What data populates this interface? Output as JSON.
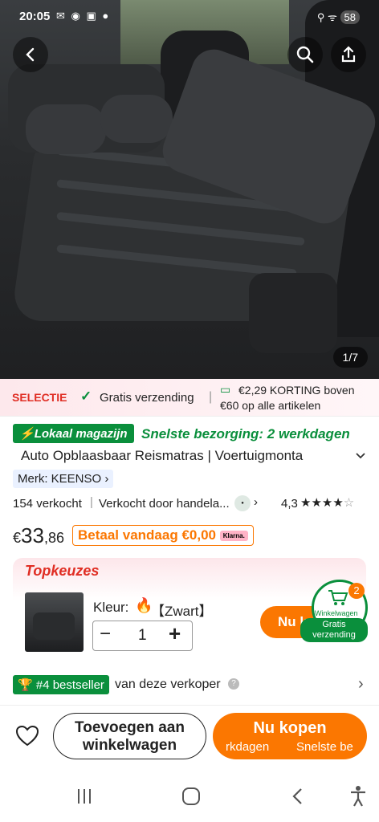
{
  "status_bar": {
    "time": "20:05",
    "battery": "58"
  },
  "gallery": {
    "counter": "1/7"
  },
  "promo": {
    "selectie": "SELECTIE",
    "shipping": "Gratis verzending",
    "discount_line1": "€2,29 KORTING boven",
    "discount_line2": "€60 op alle artikelen"
  },
  "delivery": {
    "badge": "Lokaal magazijn",
    "text": "Snelste bezorging: 2 werkdagen"
  },
  "product": {
    "title": "Auto Opblaasbaar Reismatras | Voertuigmonta",
    "brand": "Merk: KEENSO",
    "sold": "154 verkocht",
    "seller": "Verkocht door handela...",
    "rating": "4,3",
    "price_symbol": "€",
    "price_main": "33",
    "price_cents": ",86",
    "pay_today": "Betaal vandaag €0,00",
    "klarna": "Klarna."
  },
  "topkeuzes": {
    "title": "Topkeuzes",
    "color_label": "Kleur:",
    "color_value": "【Zwart】",
    "quantity": "1",
    "buy_now": "Nu k",
    "cart_badge_count": "2",
    "cart_label": "Winkelwagen",
    "cart_free": "Gratis verzending"
  },
  "bestseller": {
    "badge": "#4 bestseller",
    "text": "van deze verkoper"
  },
  "bottom": {
    "add_to_cart": "Toevoegen aan winkelwagen",
    "buy_now": "Nu kopen",
    "buy_sub1": "rkdagen",
    "buy_sub2": "Snelste be"
  },
  "colors": {
    "orange": "#fb7701",
    "green": "#0a8f3c",
    "red": "#e02e24"
  }
}
